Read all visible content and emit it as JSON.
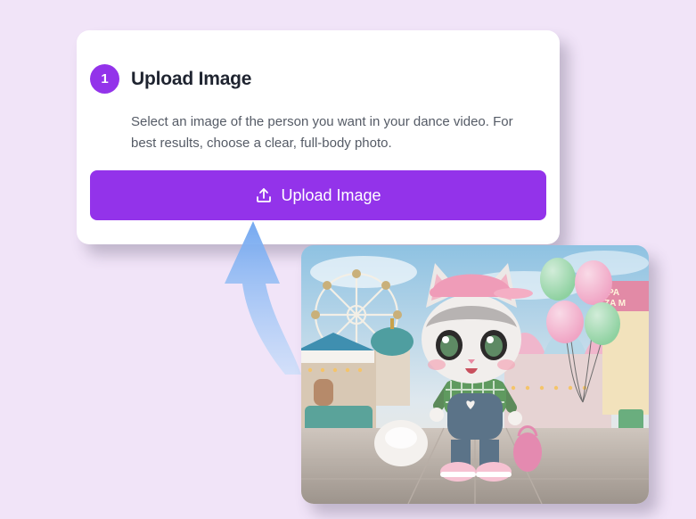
{
  "step": {
    "number": "1",
    "title": "Upload Image",
    "description": "Select an image of the person you want in your dance video. For best results, choose a clear, full-body photo.",
    "button_label": "Upload Image",
    "button_icon": "upload-icon"
  },
  "preview": {
    "signs": [
      "PA",
      "ZA M"
    ]
  },
  "colors": {
    "accent": "#9333ea",
    "background": "#f1e4f8",
    "arrow": "#7fb0f0"
  }
}
